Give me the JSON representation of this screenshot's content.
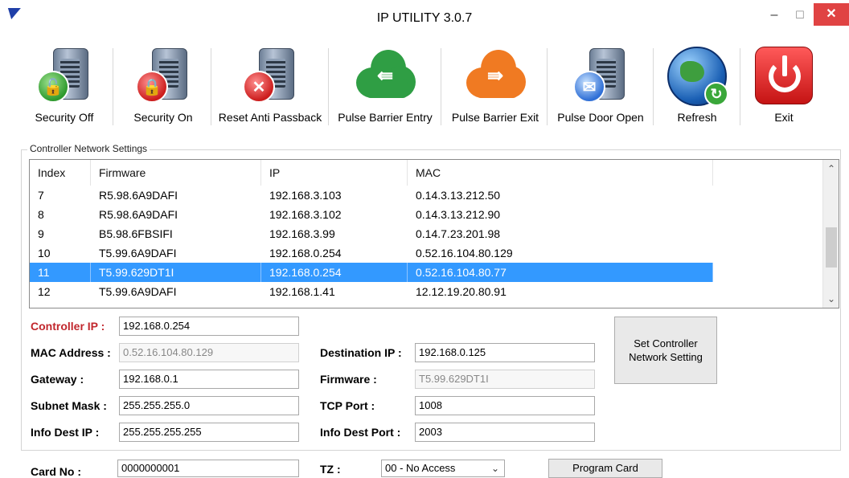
{
  "window": {
    "title": "IP UTILITY 3.0.7",
    "minimize_glyph": "–",
    "maximize_glyph": "☐",
    "close_glyph": "✕"
  },
  "toolbar": {
    "security_off": "Security Off",
    "security_on": "Security On",
    "reset_anti_passback": "Reset Anti Passback",
    "pulse_barrier_entry": "Pulse Barrier Entry",
    "pulse_barrier_exit": "Pulse Barrier Exit",
    "pulse_door_open": "Pulse Door Open",
    "refresh": "Refresh",
    "exit": "Exit"
  },
  "group": {
    "title": "Controller Network Settings"
  },
  "list": {
    "columns": [
      "Index",
      "Firmware",
      "IP",
      "MAC"
    ],
    "rows": [
      {
        "index": "7",
        "firmware": "R5.98.6A9DAFI",
        "ip": "192.168.3.103",
        "mac": "0.14.3.13.212.50"
      },
      {
        "index": "8",
        "firmware": "R5.98.6A9DAFI",
        "ip": "192.168.3.102",
        "mac": "0.14.3.13.212.90"
      },
      {
        "index": "9",
        "firmware": "B5.98.6FBSIFI",
        "ip": "192.168.3.99",
        "mac": "0.14.7.23.201.98"
      },
      {
        "index": "10",
        "firmware": "T5.99.6A9DAFI",
        "ip": "192.168.0.254",
        "mac": "0.52.16.104.80.129"
      },
      {
        "index": "11",
        "firmware": "T5.99.629DT1I",
        "ip": "192.168.0.254",
        "mac": "0.52.16.104.80.77"
      },
      {
        "index": "12",
        "firmware": "T5.99.6A9DAFI",
        "ip": "192.168.1.41",
        "mac": "12.12.19.20.80.91"
      }
    ],
    "selected_index": "11"
  },
  "form": {
    "controller_ip_label": "Controller IP :",
    "controller_ip": "192.168.0.254",
    "mac_address_label": "MAC Address :",
    "mac_address": "0.52.16.104.80.129",
    "gateway_label": "Gateway :",
    "gateway": "192.168.0.1",
    "subnet_mask_label": "Subnet Mask :",
    "subnet_mask": "255.255.255.0",
    "info_dest_ip_label": "Info Dest IP :",
    "info_dest_ip": "255.255.255.255",
    "destination_ip_label": "Destination IP :",
    "destination_ip": "192.168.0.125",
    "firmware_label": "Firmware :",
    "firmware": "T5.99.629DT1I",
    "tcp_port_label": "TCP Port :",
    "tcp_port": "1008",
    "info_dest_port_label": "Info Dest Port :",
    "info_dest_port": "2003",
    "set_controller_button": "Set Controller Network Setting",
    "card_no_label": "Card No :",
    "card_no": "0000000001",
    "tz_label": "TZ :",
    "tz": "00 - No Access",
    "program_card_button": "Program Card"
  }
}
